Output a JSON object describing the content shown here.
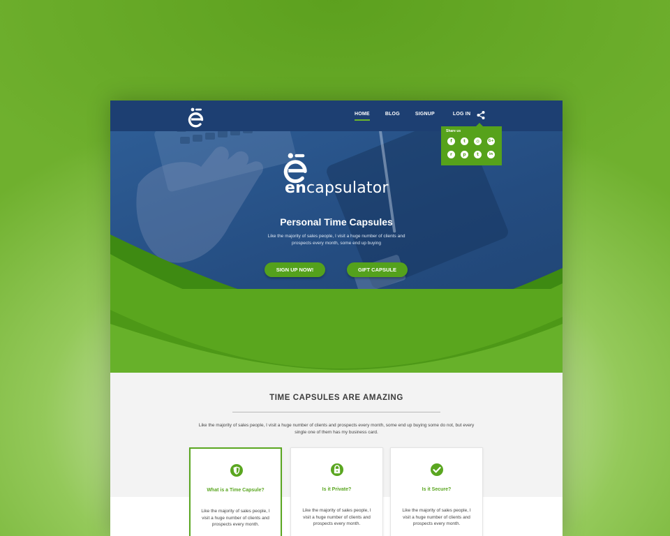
{
  "colors": {
    "brand_green": "#56a21b",
    "navy": "#1d3f72",
    "hero_blue": "#2a5690",
    "page_bg": "#f3f3f3"
  },
  "brand": {
    "prefix": "en",
    "suffix": "capsulator",
    "logo_icon": "e-capsule-logo-icon"
  },
  "nav": {
    "items": [
      {
        "label": "HOME"
      },
      {
        "label": "BLOG"
      },
      {
        "label": "SIGNUP"
      },
      {
        "label": "LOG IN"
      }
    ],
    "share_icon": "share-icon"
  },
  "share": {
    "title": "Share us",
    "networks": [
      {
        "icon": "facebook-icon",
        "glyph": "f"
      },
      {
        "icon": "twitter-icon",
        "glyph": "t"
      },
      {
        "icon": "instagram-icon",
        "glyph": "◎"
      },
      {
        "icon": "google-plus-icon",
        "glyph": "G+"
      },
      {
        "icon": "reddit-icon",
        "glyph": "r"
      },
      {
        "icon": "pinterest-icon",
        "glyph": "p"
      },
      {
        "icon": "tumblr-icon",
        "glyph": "t"
      },
      {
        "icon": "linkedin-icon",
        "glyph": "in"
      }
    ]
  },
  "hero": {
    "title": "Personal Time Capsules",
    "subtitle": "Like the majority of sales people, I visit a huge number of clients and prospects every month, some end up buying",
    "cta_primary": "SIGN UP NOW!",
    "cta_secondary": "GIFT CAPSULE"
  },
  "intro": {
    "title": "TIME CAPSULES ARE AMAZING",
    "text": "Like the majority of sales people, I visit a huge number of clients and prospects every month, some end up buying some do not, but every single one of them has my business card."
  },
  "cards": [
    {
      "icon": "shield-icon",
      "title": "What is a Time Capsule?",
      "text": "Like the majority of sales people, I visit a huge number of clients and prospects every month."
    },
    {
      "icon": "lock-icon",
      "title": "Is it Private?",
      "text": "Like the majority of sales people, I visit a huge number of clients and prospects every month."
    },
    {
      "icon": "check-circle-icon",
      "title": "Is it Secure?",
      "text": "Like the majority of sales people, I visit a huge number of clients and prospects every month."
    }
  ]
}
